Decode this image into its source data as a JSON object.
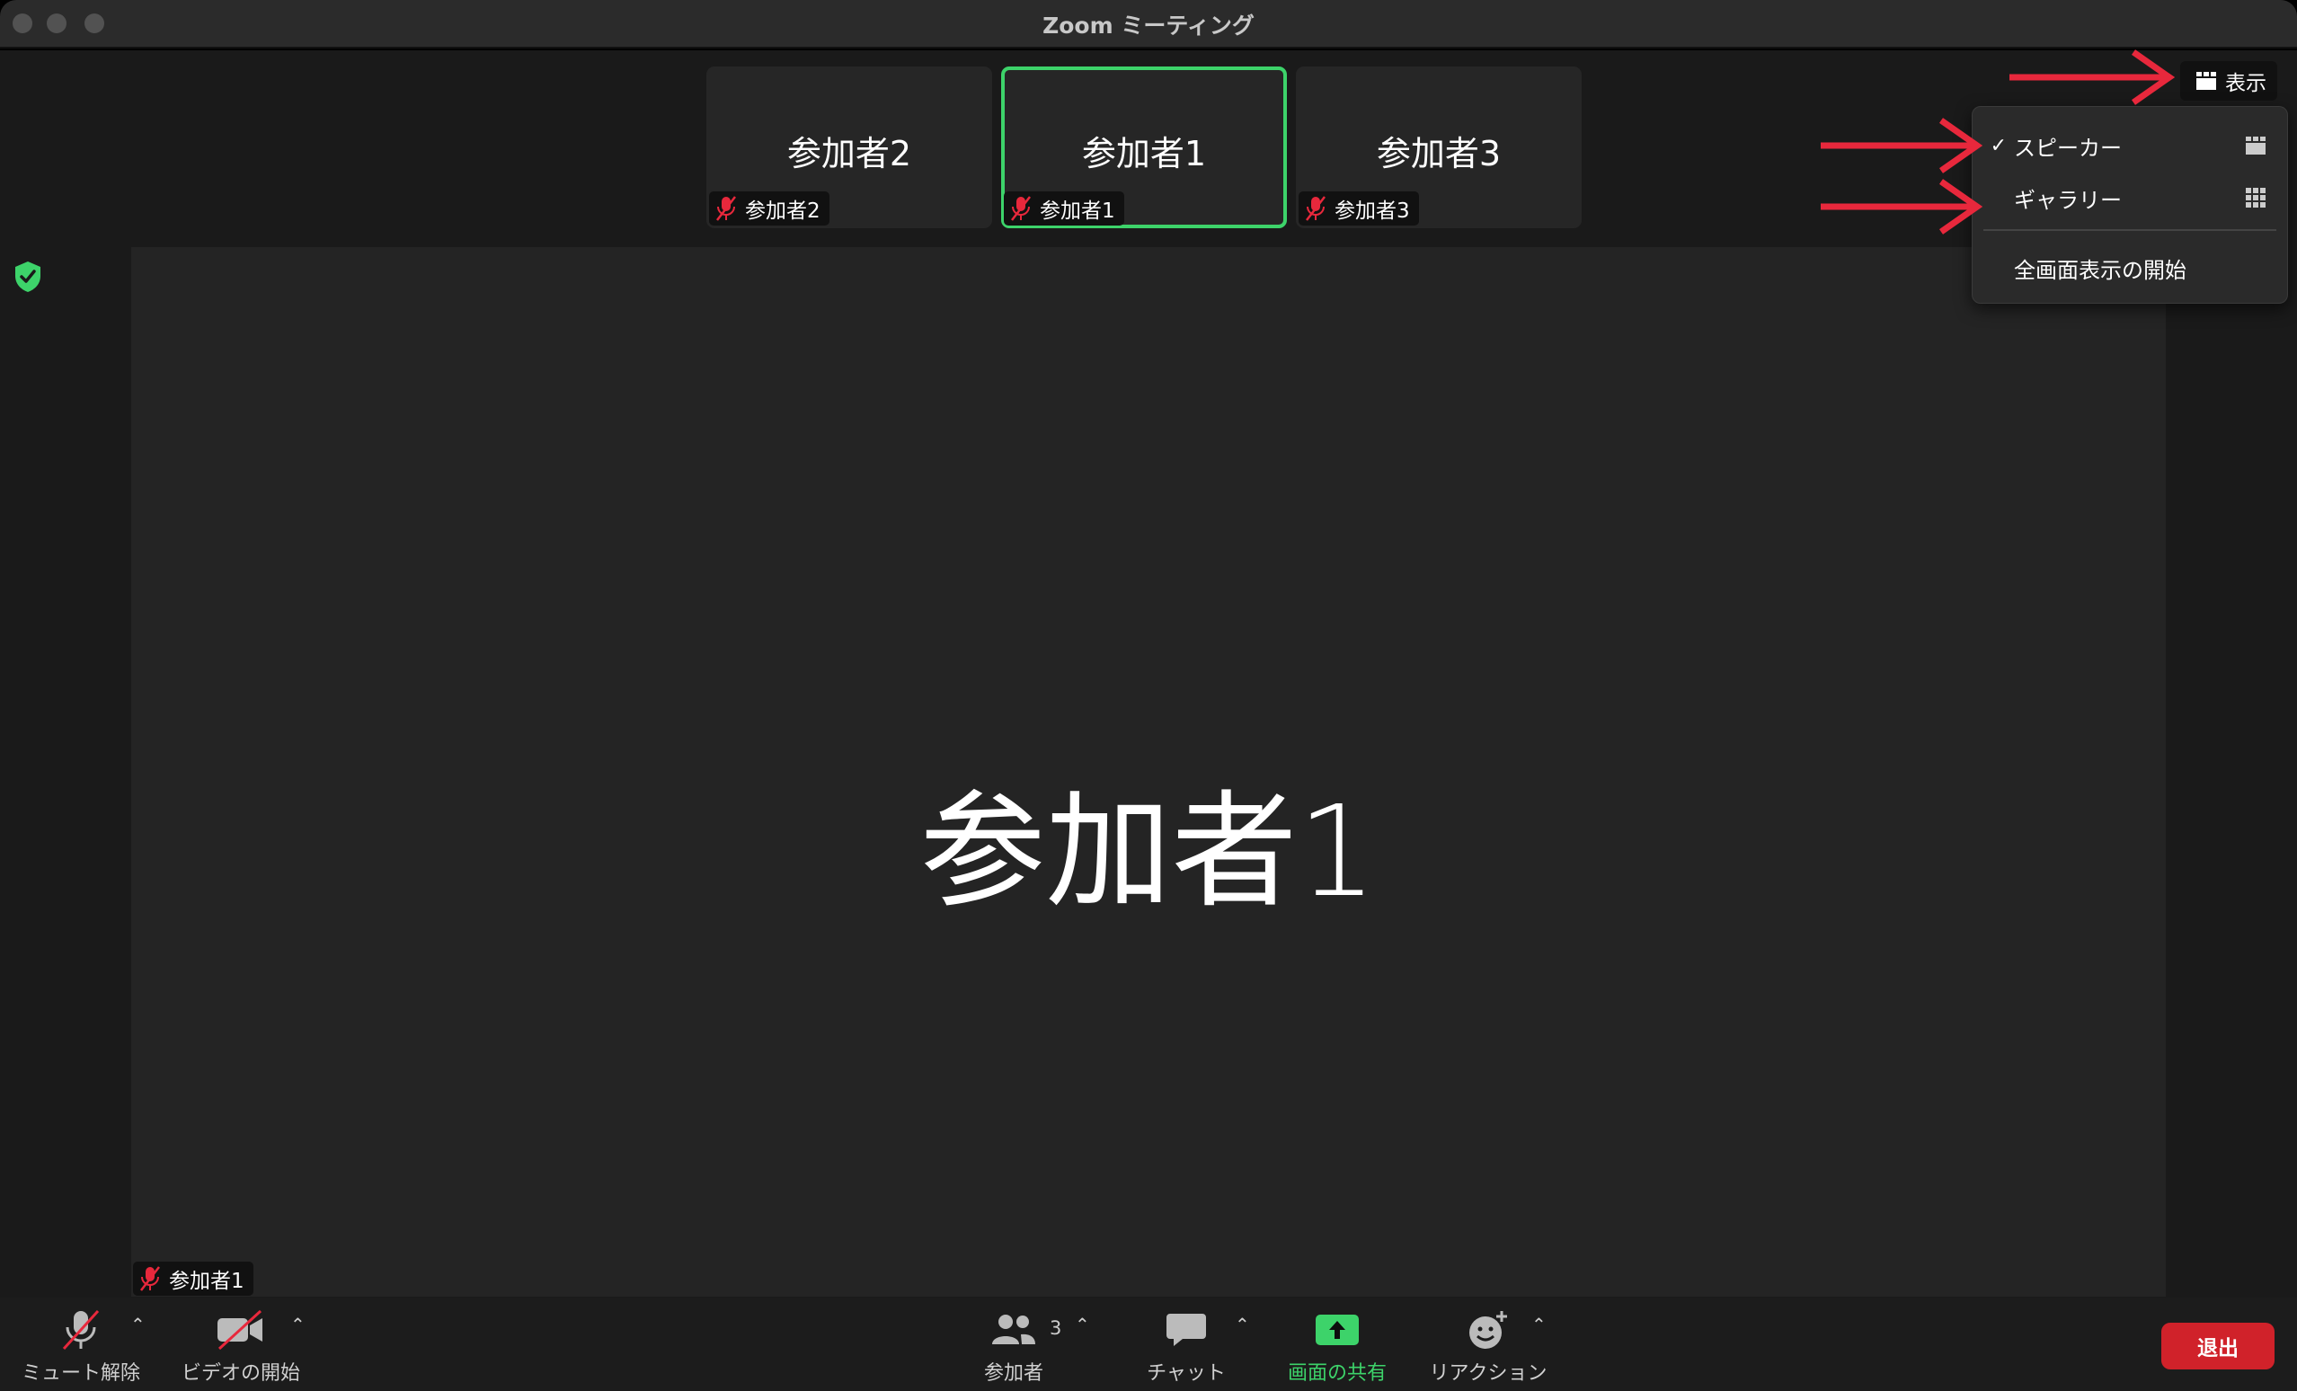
{
  "window": {
    "title": "Zoom ミーティング"
  },
  "thumbnails": [
    {
      "name": "参加者2",
      "tag": "参加者2",
      "active": false
    },
    {
      "name": "参加者1",
      "tag": "参加者1",
      "active": true
    },
    {
      "name": "参加者3",
      "tag": "参加者3",
      "active": false
    }
  ],
  "speaker": {
    "name": "参加者1",
    "tag": "参加者1"
  },
  "view_button": {
    "label": "表示",
    "icon": "speaker-layout-icon"
  },
  "view_menu": {
    "items": [
      {
        "label": "スピーカー",
        "checked": true,
        "icon": "speaker-layout-icon"
      },
      {
        "label": "ギャラリー",
        "checked": false,
        "icon": "gallery-grid-icon"
      },
      {
        "label": "全画面表示の開始",
        "checked": false
      }
    ]
  },
  "toolbar": {
    "mute_label": "ミュート解除",
    "video_label": "ビデオの開始",
    "participants_label": "参加者",
    "participants_count": "3",
    "chat_label": "チャット",
    "share_label": "画面の共有",
    "reactions_label": "リアクション",
    "leave_label": "退出"
  },
  "colors": {
    "accent_green": "#3dd36a",
    "leave_red": "#d0222a",
    "annotation_arrow": "#e8283c"
  }
}
